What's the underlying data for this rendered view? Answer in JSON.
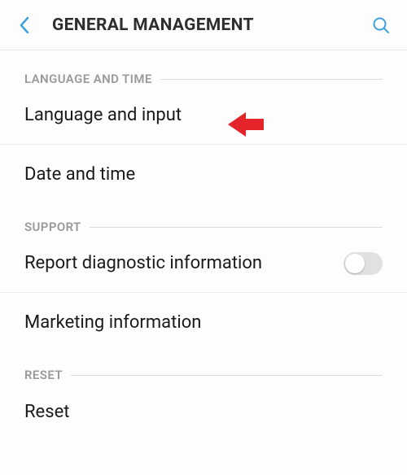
{
  "header": {
    "title": "GENERAL MANAGEMENT"
  },
  "sections": {
    "s0": {
      "label": "LANGUAGE AND TIME",
      "items": {
        "i0": "Language and input",
        "i1": "Date and time"
      }
    },
    "s1": {
      "label": "SUPPORT",
      "items": {
        "i0": "Report diagnostic information",
        "i1": "Marketing information"
      }
    },
    "s2": {
      "label": "RESET",
      "items": {
        "i0": "Reset"
      }
    }
  }
}
